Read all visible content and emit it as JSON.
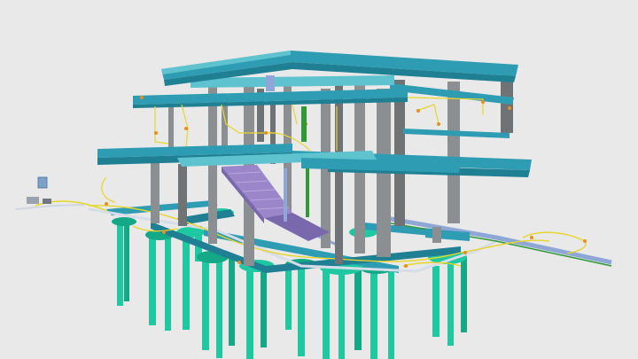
{
  "scene": {
    "subject": "bim-structural-model",
    "colors": {
      "background": "#e9e9e9",
      "slab_top": "#2e9db3",
      "slab_side": "#1f7f93",
      "column": "#8c8f92",
      "column_dark": "#707376",
      "pile": "#1ec9a2",
      "pile_dark": "#13a886",
      "beam": "#5fc3cf",
      "stair": "#9a86c9",
      "stair_dark": "#7a68ad",
      "pipe_blue": "#8ea7d6",
      "pipe_white": "#d6dde8",
      "wire_yellow": "#e8d52a",
      "wire_green": "#2f9a35",
      "fixture_orange": "#e58e22"
    }
  }
}
